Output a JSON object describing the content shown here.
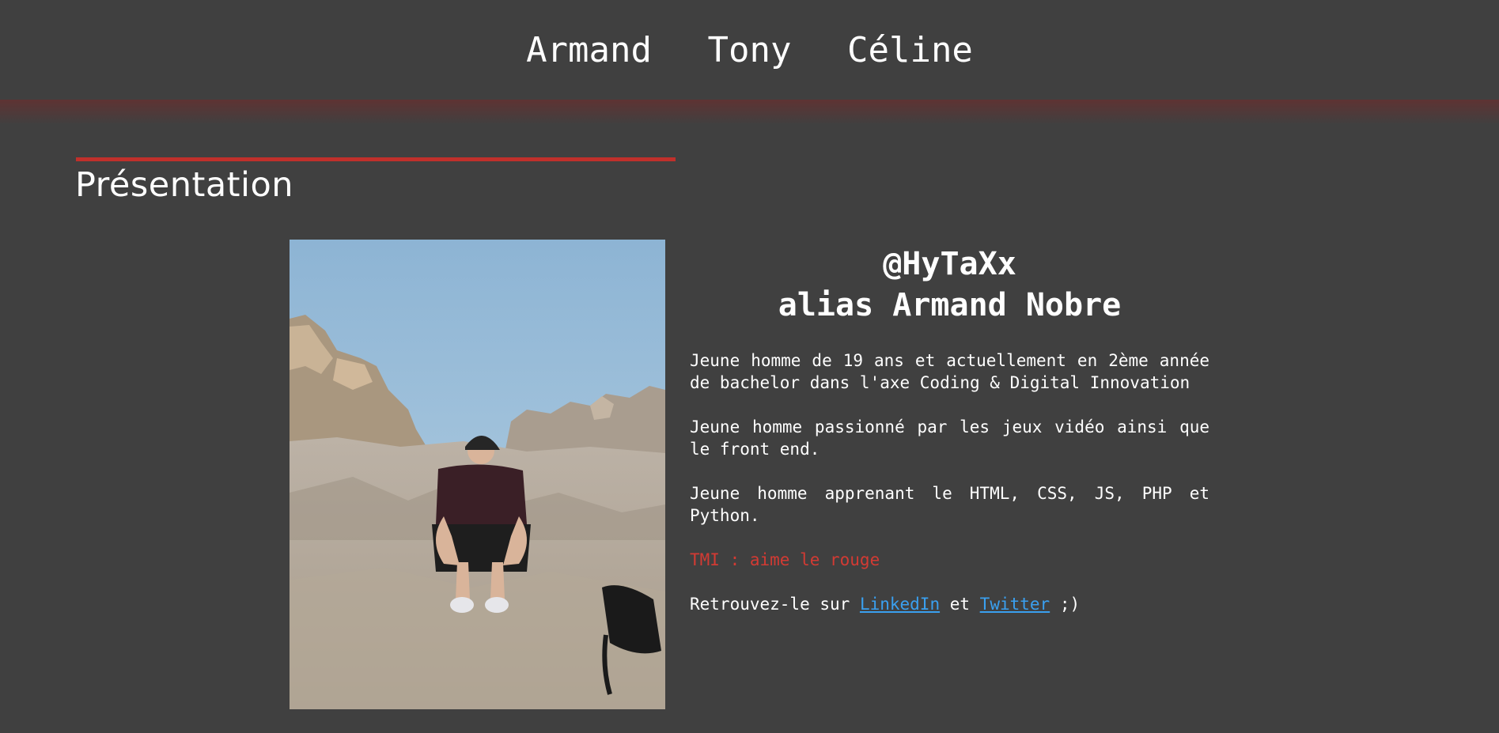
{
  "nav": {
    "links": [
      "Armand",
      "Tony",
      "Céline"
    ]
  },
  "section": {
    "title": "Présentation",
    "accent_color": "#c0302b"
  },
  "profile": {
    "handle": "@HyTaXx",
    "alias": "alias Armand Nobre",
    "paragraphs": [
      "Jeune homme de 19 ans et actuellement en 2ème année de bachelor dans l'axe Coding & Digital Innovation",
      "Jeune homme passionné par les jeux vidéo ainsi que le front end.",
      "Jeune homme apprenant le HTML, CSS, JS, PHP et Python."
    ],
    "tmi": "TMI : aime le rouge",
    "find_prefix": "Retrouvez-le sur ",
    "linkedin_label": "LinkedIn",
    "and": " et ",
    "twitter_label": "Twitter",
    "find_suffix": " ;)",
    "photo_icon": "portrait-photo-icon"
  }
}
